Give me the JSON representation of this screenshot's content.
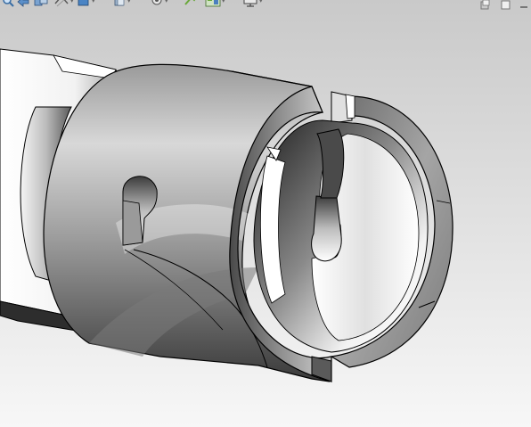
{
  "window": {
    "type": "3D CAD graphics viewport",
    "background_gradient": [
      "#c9c9c9",
      "#f7f7f7"
    ]
  },
  "heads_up_toolbar": {
    "buttons": [
      {
        "icon": "zoom-to-fit-icon",
        "has_dropdown": false
      },
      {
        "icon": "previous-view-icon",
        "has_dropdown": false
      },
      {
        "icon": "section-view-icon",
        "has_dropdown": false
      },
      {
        "icon": "view-orientation-icon",
        "has_dropdown": true
      },
      {
        "icon": "display-style-icon",
        "has_dropdown": true
      },
      {
        "icon": "hide-show-items-icon",
        "has_dropdown": true
      },
      {
        "icon": "edit-appearance-icon",
        "has_dropdown": true
      },
      {
        "icon": "apply-scene-icon",
        "has_dropdown": true
      },
      {
        "icon": "view-settings-icon",
        "has_dropdown": true
      }
    ]
  },
  "window_controls": [
    "restore-icon",
    "maximize-icon",
    "minimize-icon"
  ],
  "model": {
    "description_icon": "bayonet-coupling-part",
    "shade_dark": "#2a2a2a",
    "shade_light": "#ffffff",
    "edge_color": "#000000"
  }
}
